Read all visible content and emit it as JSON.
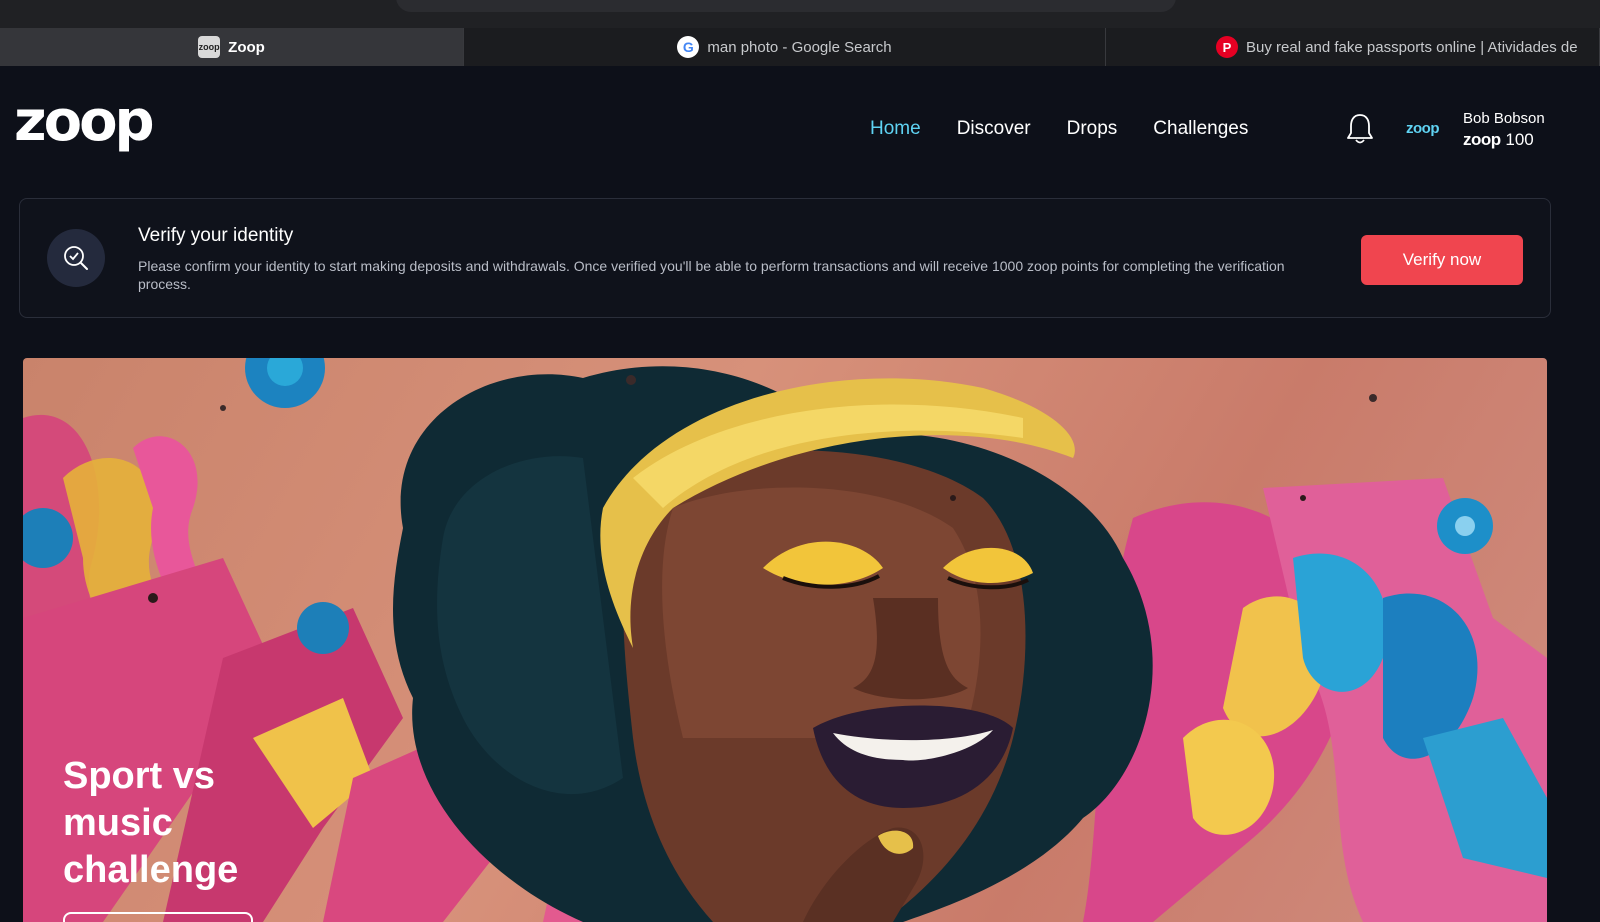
{
  "browser": {
    "tabs": [
      {
        "label": "Zoop",
        "favicon": "zoop-favicon",
        "active": true
      },
      {
        "label": "man photo - Google Search",
        "favicon": "google-favicon",
        "active": false
      },
      {
        "label": "Buy real and fake passports online | Atividades de",
        "favicon": "pinterest-favicon",
        "active": false
      }
    ]
  },
  "header": {
    "logo": "zoop",
    "nav": [
      "Home",
      "Discover",
      "Drops",
      "Challenges"
    ],
    "active_nav": "Home",
    "user": {
      "brand": "zoop",
      "name": "Bob Bobson",
      "points_brand": "zoop",
      "points": "100"
    }
  },
  "verify": {
    "title": "Verify your identity",
    "description": "Please confirm your identity to start making deposits and withdrawals. Once verified you'll be able to perform transactions and will receive 1000 zoop points for completing the verification process.",
    "button": "Verify now"
  },
  "hero": {
    "title": "Sport vs music challenge"
  },
  "colors": {
    "accent": "#5fd3f3",
    "cta": "#f0454f",
    "background": "#0d1019"
  }
}
